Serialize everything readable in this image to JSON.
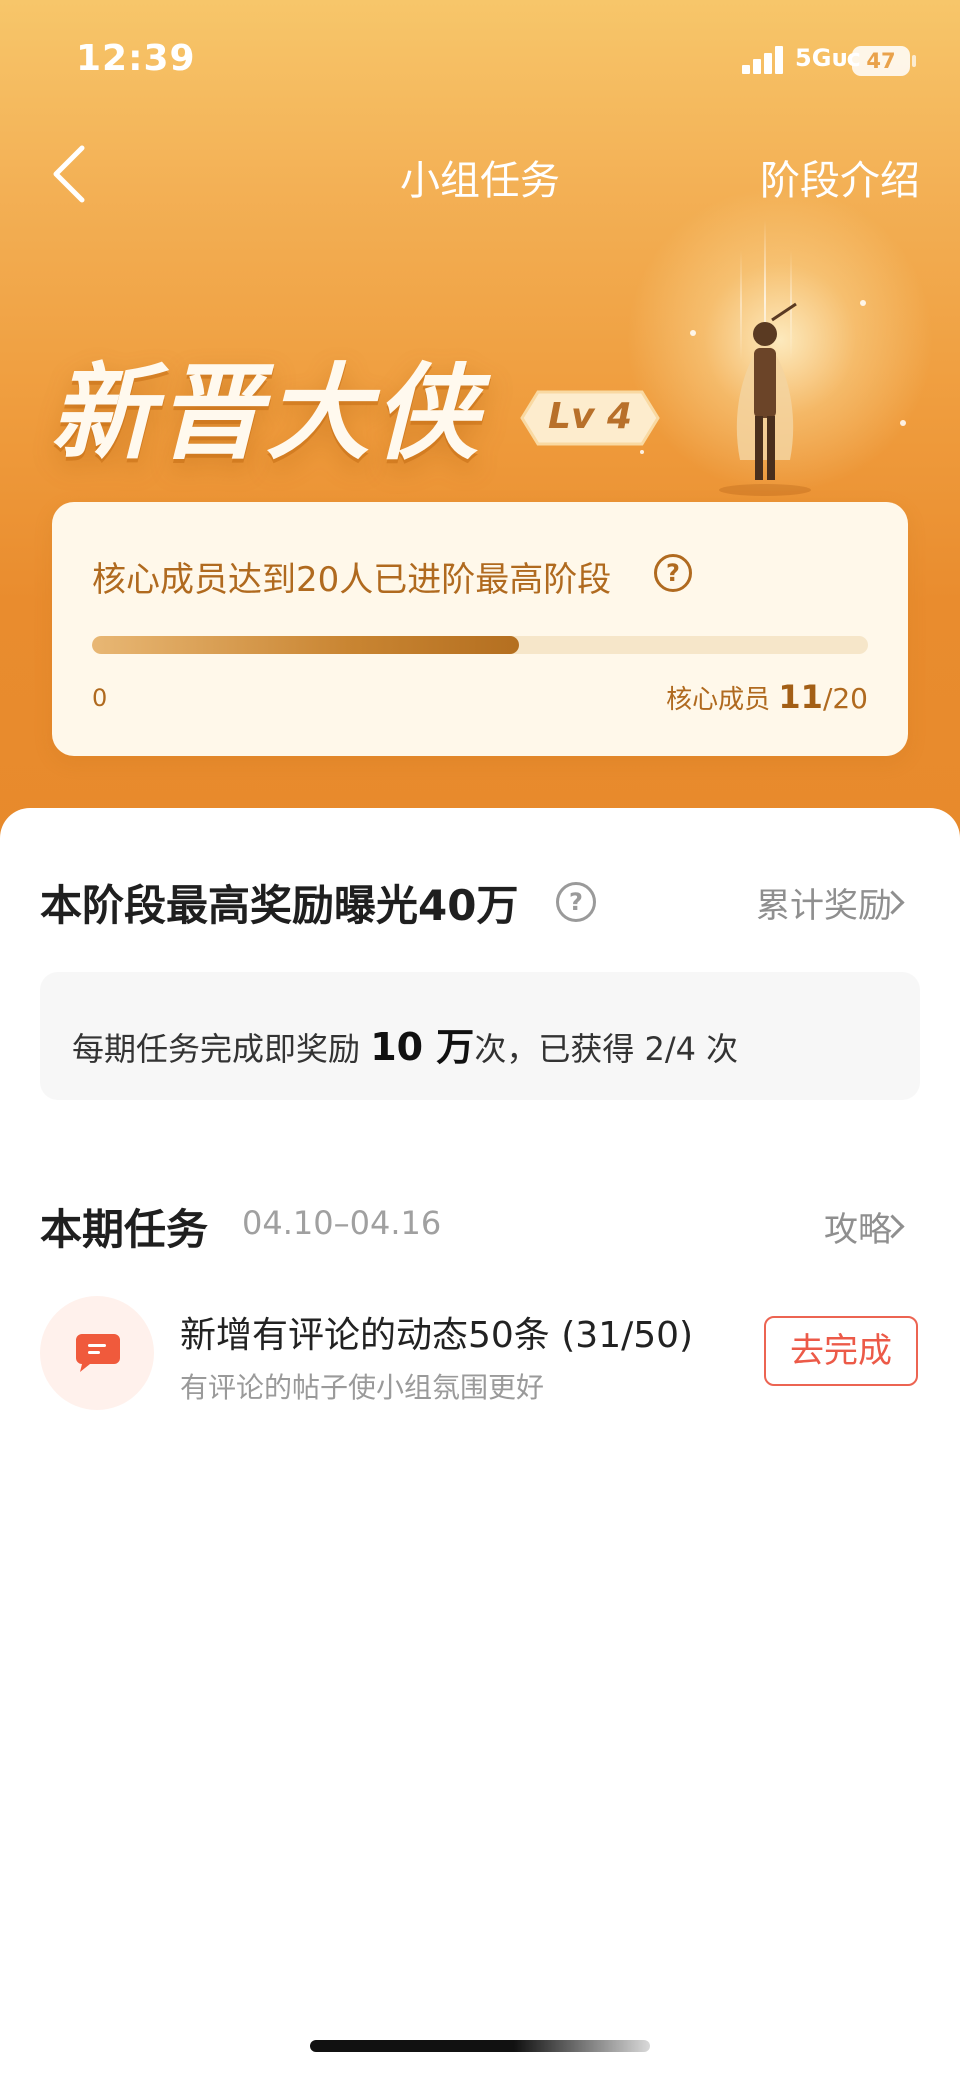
{
  "status_bar": {
    "time": "12:39",
    "network": "5Gᴜᴄ",
    "battery": "47"
  },
  "nav": {
    "title": "小组任务",
    "right_link": "阶段介绍"
  },
  "level": {
    "name": "新晋大侠",
    "badge": "Lv 4"
  },
  "progress": {
    "description": "核心成员达到20人已进阶最高阶段",
    "help_glyph": "?",
    "min_label": "0",
    "right_label": "核心成员",
    "current": "11",
    "total_text": "/20",
    "fraction": 0.55
  },
  "reward": {
    "title": "本阶段最高奖励曝光40万",
    "help_glyph": "?",
    "link": "累计奖励",
    "desc_prefix": "每期任务完成即奖励",
    "desc_amount": "10 万",
    "desc_suffix": "次，已获得 2/4 次"
  },
  "tasks": {
    "title": "本期任务",
    "date_range": "04.10–04.16",
    "link": "攻略",
    "items": [
      {
        "icon": "comment-bubble-icon",
        "name": "新增有评论的动态50条 (31/50)",
        "subtitle": "有评论的帖子使小组氛围更好",
        "action": "去完成"
      }
    ]
  },
  "colors": {
    "accent_orange": "#ef9c3d",
    "progress_brown": "#b06a1f",
    "task_red": "#ec5a48"
  }
}
